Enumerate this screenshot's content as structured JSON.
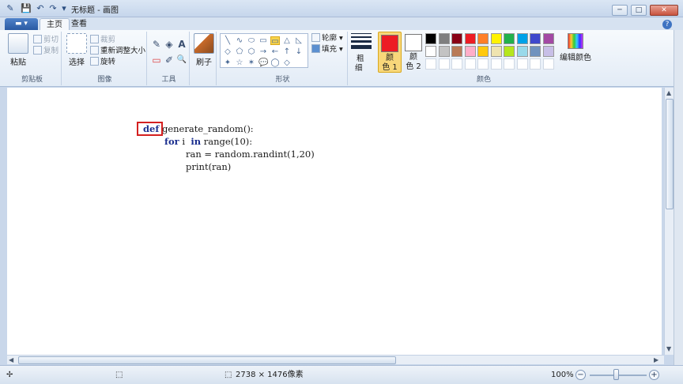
{
  "window": {
    "title": "无标题 - 画图",
    "minimize": "─",
    "maximize": "□",
    "close": "✕"
  },
  "quick_access": {
    "save": "💾",
    "undo": "↶",
    "redo": "↷",
    "more": "▾"
  },
  "tabs": {
    "app_menu": "▬ ▾",
    "home": "主页",
    "view": "查看",
    "help": "?"
  },
  "ribbon": {
    "clipboard": {
      "label": "剪贴板",
      "paste": "粘贴",
      "cut": "剪切",
      "copy": "复制"
    },
    "image": {
      "label": "图像",
      "select": "选择",
      "crop": "裁剪",
      "resize": "重新调整大小",
      "rotate": "旋转"
    },
    "tools": {
      "label": "工具",
      "pencil": "✎",
      "fill": "◈",
      "text": "A",
      "eraser": "▭",
      "picker": "✐",
      "magnifier": "🔍"
    },
    "brushes": {
      "label": "刷子"
    },
    "shapes": {
      "label": "形状",
      "outline": "轮廓",
      "fill": "填充",
      "items": [
        "╲",
        "∿",
        "⬭",
        "▭",
        "▭",
        "△",
        "◺",
        "◇",
        "⬠",
        "⬡",
        "→",
        "←",
        "↑",
        "↓",
        "✦",
        "☆",
        "✶",
        "💬",
        "◯",
        "◇"
      ]
    },
    "size": {
      "label_top": "粗",
      "label_bottom": "细"
    },
    "colors": {
      "label": "颜色",
      "color1_label_a": "颜",
      "color1_label_b": "色 1",
      "color2_label_a": "颜",
      "color2_label_b": "色 2",
      "color1": "#ed1c24",
      "color2": "#ffffff",
      "edit": "编辑颜色",
      "palette_row1": [
        "#000000",
        "#7f7f7f",
        "#880015",
        "#ed1c24",
        "#ff7f27",
        "#fff200",
        "#22b14c",
        "#00a2e8",
        "#3f48cc",
        "#a349a4"
      ],
      "palette_row2": [
        "#ffffff",
        "#c3c3c3",
        "#b97a57",
        "#ffaec9",
        "#ffc90e",
        "#efe4b0",
        "#b5e61d",
        "#99d9ea",
        "#7092be",
        "#c8bfe7"
      ],
      "palette_row3": [
        "#ffffff",
        "#ffffff",
        "#ffffff",
        "#ffffff",
        "#ffffff",
        "#ffffff",
        "#ffffff",
        "#ffffff",
        "#ffffff",
        "#ffffff"
      ]
    }
  },
  "canvas": {
    "code_lines": [
      {
        "kw": "def",
        "rest": " generate_random():"
      },
      {
        "kw": "for",
        "rest": " i  ",
        "kw2": "in",
        "rest2": " range(10):"
      },
      {
        "plain": "ran = random.randint(1,20)"
      },
      {
        "plain": "print(ran)"
      }
    ]
  },
  "statusbar": {
    "move_icon": "✢",
    "select_icon": "⬚",
    "size_icon": "⬚",
    "dimensions": "2738 × 1476像素",
    "zoom": "100%",
    "zoom_out": "−",
    "zoom_in": "+"
  }
}
